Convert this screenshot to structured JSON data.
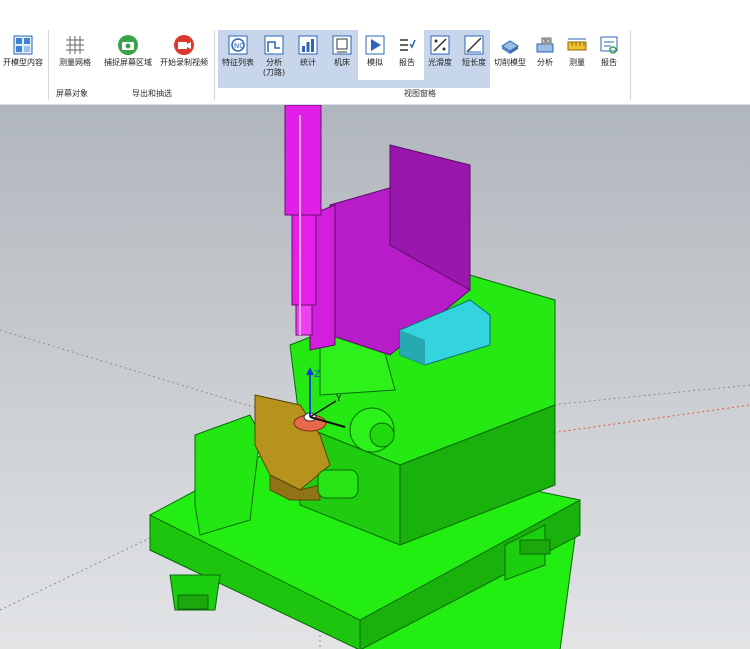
{
  "ribbon": {
    "groups": {
      "display_objects": "屏幕对象",
      "export_capture": "导出和抽选",
      "tool_views": "视图窗格"
    },
    "buttons": {
      "model_content": "开模型内容",
      "measure_grid": "测量网格",
      "capture_region": "捕捉屏幕区域",
      "start_record": "开始录制视频",
      "feature_list": "特征列表",
      "analysis": "分析",
      "analysis_sub": "(刀路)",
      "stats": "统计",
      "machine": "机床",
      "simulate": "模拟",
      "reset": "报告",
      "tolerance": "光滑度",
      "curvature": "短长度",
      "cut_model": "切削模型",
      "analyze": "分析",
      "measure": "测量",
      "report": "报告"
    },
    "icons": {
      "model_content": "model-grid-icon",
      "measure_grid": "grid-icon",
      "capture_region": "camera-icon",
      "start_record": "video-record-icon",
      "feature_list": "feature-list-icon",
      "analysis": "toolpath-analysis-icon",
      "stats": "bar-chart-icon",
      "machine": "machine-icon",
      "simulate": "play-icon",
      "reset": "list-icon",
      "tolerance": "tolerance-icon",
      "curvature": "curvature-icon",
      "cut_model": "cut-model-icon",
      "analyze": "analyze-icon",
      "measure": "ruler-icon",
      "report": "report-icon"
    }
  },
  "colors": {
    "ribbon_selected": "#c7d6ea",
    "machine_green": "#22ee11",
    "spindle_magenta": "#e21de6",
    "column_purple": "#b01fc2",
    "block_cyan": "#32d3dc",
    "fixture_gold": "#b3921c"
  }
}
